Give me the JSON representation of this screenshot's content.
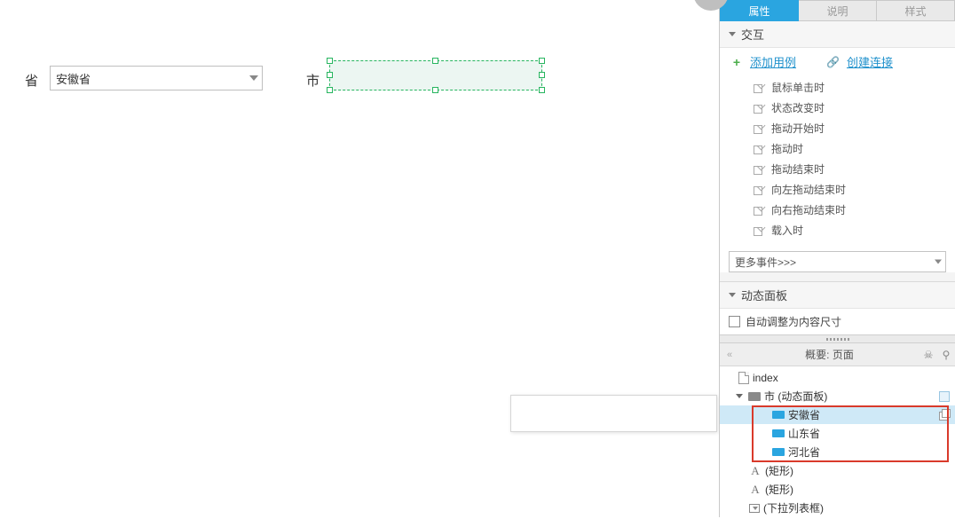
{
  "canvas": {
    "province_label": "省",
    "city_label": "市",
    "province_select_value": "安徽省"
  },
  "tabs": {
    "attributes": "属性",
    "notes": "说明",
    "style": "样式"
  },
  "interaction": {
    "header": "交互",
    "add_case": "添加用例",
    "create_link": "创建连接",
    "events": [
      "鼠标单击时",
      "状态改变时",
      "拖动开始时",
      "拖动时",
      "拖动结束时",
      "向左拖动结束时",
      "向右拖动结束时",
      "载入时"
    ],
    "more_events": "更多事件>>>"
  },
  "dynamic_panel": {
    "header": "动态面板",
    "auto_fit": "自动调整为内容尺寸"
  },
  "outline": {
    "header": "概要: 页面",
    "items": {
      "page": "index",
      "panel": "市 (动态面板)",
      "state1": "安徽省",
      "state2": "山东省",
      "state3": "河北省",
      "rectA": "(矩形)",
      "rectB": "(矩形)",
      "droplist": "(下拉列表框)"
    }
  }
}
